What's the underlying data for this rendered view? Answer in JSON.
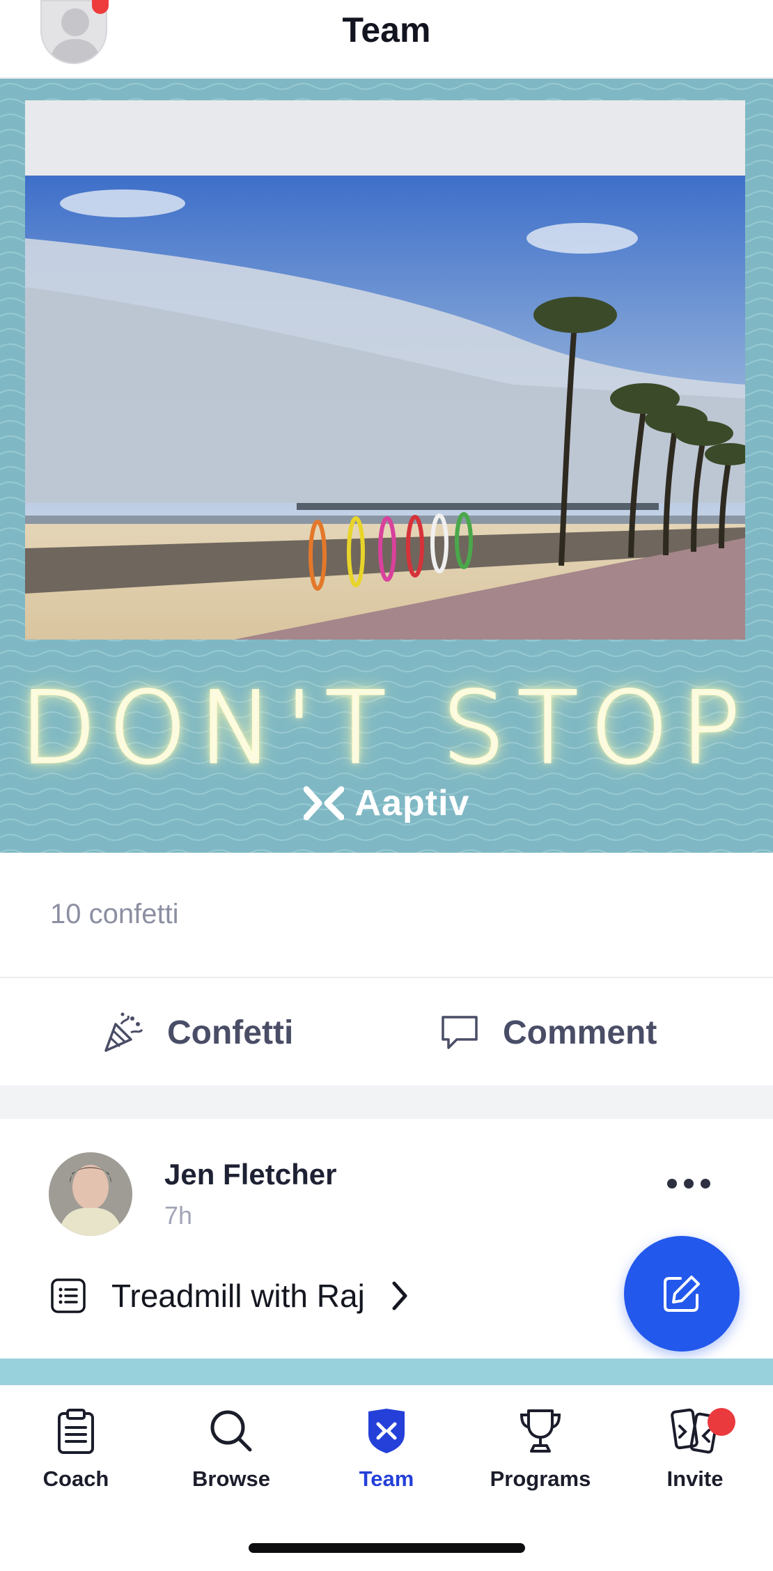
{
  "header": {
    "title": "Team"
  },
  "banner": {
    "headline": "DON'T STOP",
    "brand": "Aaptiv"
  },
  "post": {
    "confetti_count": "10 confetti",
    "actions": {
      "confetti": "Confetti",
      "comment": "Comment"
    }
  },
  "next_post": {
    "author": "Jen Fletcher",
    "time": "7h",
    "workout": "Treadmill with Raj"
  },
  "tabs": [
    {
      "label": "Coach",
      "icon": "clipboard-icon"
    },
    {
      "label": "Browse",
      "icon": "search-icon"
    },
    {
      "label": "Team",
      "icon": "team-shield-icon",
      "active": true
    },
    {
      "label": "Programs",
      "icon": "trophy-icon"
    },
    {
      "label": "Invite",
      "icon": "invite-phones-icon",
      "badge": true
    }
  ],
  "colors": {
    "accent": "#2358ec",
    "active_tab": "#2440d9",
    "badge": "#ea3a3e",
    "banner_bg": "#7fb8c4"
  }
}
